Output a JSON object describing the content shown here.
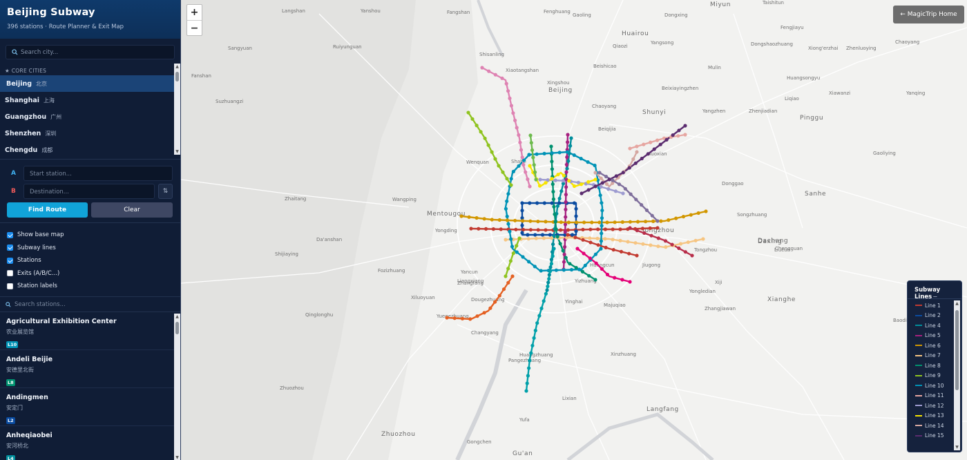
{
  "app": {
    "title": "Beijing Subway",
    "subtitle": "396 stations · Route Planner & Exit Map"
  },
  "city_search": {
    "placeholder": "Search city..."
  },
  "cities": {
    "section": "★ CORE CITIES",
    "items": [
      {
        "en": "Beijing",
        "zh": "北京",
        "active": true
      },
      {
        "en": "Shanghai",
        "zh": "上海",
        "active": false
      },
      {
        "en": "Guangzhou",
        "zh": "广州",
        "active": false
      },
      {
        "en": "Shenzhen",
        "zh": "深圳",
        "active": false
      },
      {
        "en": "Chengdu",
        "zh": "成都",
        "active": false
      }
    ]
  },
  "route": {
    "a_label": "A",
    "b_label": "B",
    "start_placeholder": "Start station...",
    "dest_placeholder": "Destination...",
    "swap_glyph": "⇅",
    "find_label": "Find Route",
    "clear_label": "Clear"
  },
  "toggles": [
    {
      "label": "Show base map",
      "checked": true
    },
    {
      "label": "Subway lines",
      "checked": true
    },
    {
      "label": "Stations",
      "checked": true
    },
    {
      "label": "Exits (A/B/C...)",
      "checked": false
    },
    {
      "label": "Station labels",
      "checked": false
    }
  ],
  "station_search": {
    "placeholder": "Search stations..."
  },
  "stations": [
    {
      "name": "Agricultural Exhibition Center",
      "zh": "农业展览馆",
      "line": "L10",
      "color": "#0093b6"
    },
    {
      "name": "Andeli Beijie",
      "zh": "安德里北街",
      "line": "L8",
      "color": "#00916f"
    },
    {
      "name": "Andingmen",
      "zh": "安定门",
      "line": "L2",
      "color": "#0a4ba0"
    },
    {
      "name": "Anheqiaobei",
      "zh": "安河桥北",
      "line": "L4",
      "color": "#008e9c"
    }
  ],
  "map": {
    "zoom_in": "+",
    "zoom_out": "−",
    "home_button": "← MagicTrip Home",
    "labels": [
      "Langshan",
      "Yanshou",
      "Fangshan",
      "Fenghuang",
      "Miyun",
      "Taishitun",
      "Sangyuan",
      "Ruiyunguan",
      "Qiaozi",
      "Yangsong",
      "Gaoling",
      "Dongxing",
      "Fanshan",
      "Shisanling",
      "Dongshaozhuang",
      "Xingshou",
      "Huairou",
      "Beishicao",
      "Mulin",
      "Beixiayingzhen",
      "Fengjiayu",
      "Huangsongyu",
      "Zhenluoying",
      "Xiong'erzhai",
      "Suzhuangzi",
      "Chaoyang",
      "Xiaotangshan",
      "Beiqijia",
      "Liqiao",
      "Yangzhen",
      "Zhenjiadian",
      "Xiawanzi",
      "Pinggu",
      "Yanqing",
      "Shahe",
      "Gaoliying",
      "Huoxian",
      "Donggao",
      "Daxing",
      "Liucun",
      "Tongzhou",
      "Majuqiao",
      "Huangcun",
      "Jiugong",
      "Songzhuang",
      "Yongledian",
      "Mentougou",
      "Yongding",
      "Yancun",
      "Liangxiang",
      "Dougezhuang",
      "Yuegezhuang",
      "Huangzhuang",
      "Zhuozhou",
      "Gu'an",
      "Shijiaying",
      "Tongzhou",
      "Xiji",
      "Yizhuang",
      "Yinghai",
      "Zhangjiawan",
      "Beijing",
      "Chaoyang",
      "Dachang",
      "Sanhe",
      "Langfang",
      "Chengguan",
      "Xianghe",
      "Baodi",
      "Shunyi",
      "Wenquan",
      "Zhaitang",
      "Wangping",
      "Da'anshan",
      "Fozizhuang",
      "Qinglonghu",
      "Changyang",
      "Xiluoyuan",
      "Zhangfang",
      "Pangezhuang",
      "Yufa",
      "Lixian",
      "Zhuozhou",
      "Gongchen",
      "Xinzhuang"
    ]
  },
  "legend": {
    "title": "Subway Lines",
    "collapse_glyph": "−",
    "lines": [
      {
        "name": "Line 1",
        "color": "#c23a30"
      },
      {
        "name": "Line 2",
        "color": "#0a4ba0"
      },
      {
        "name": "Line 4",
        "color": "#008e9c"
      },
      {
        "name": "Line 5",
        "color": "#a6217f"
      },
      {
        "name": "Line 6",
        "color": "#d29700"
      },
      {
        "name": "Line 7",
        "color": "#f6c582"
      },
      {
        "name": "Line 8",
        "color": "#00916f"
      },
      {
        "name": "Line 9",
        "color": "#8fc31f"
      },
      {
        "name": "Line 10",
        "color": "#0093b6"
      },
      {
        "name": "Line 11",
        "color": "#e6a5a0"
      },
      {
        "name": "Line 12",
        "color": "#9d9bd0"
      },
      {
        "name": "Line 13",
        "color": "#f8e400"
      },
      {
        "name": "Line 14",
        "color": "#d5a7a1"
      },
      {
        "name": "Line 15",
        "color": "#5b2c6f"
      }
    ]
  }
}
